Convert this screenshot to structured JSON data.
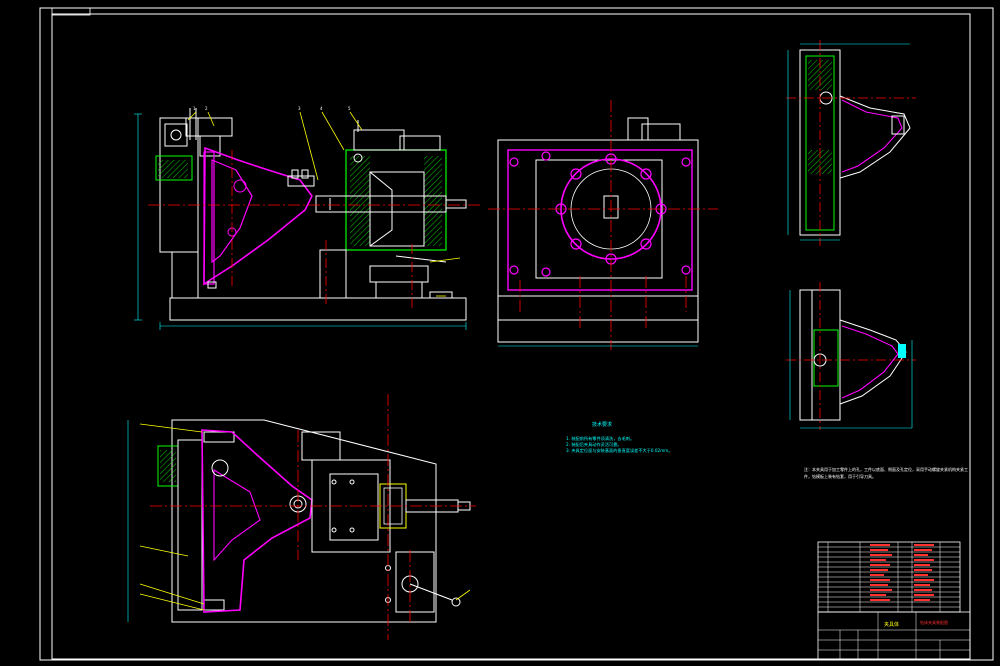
{
  "drawing": {
    "title_block": {
      "designation": "夹具体",
      "title": "钻床夹具装配图",
      "parts_table_rows": 14
    },
    "technical_requirements": {
      "heading": "技术要求",
      "items": [
        "1. 装配前所有零件须清洗，去毛刺。",
        "2. 装配后夹具动作灵活可靠。",
        "3. 夹具定位面与安装基面的垂直度误差不大于0.02mm。"
      ]
    },
    "side_notes": "注：本夹具用于加工零件上的孔，工件以底面、侧面及孔定位，采用手动螺旋夹紧机构夹紧工件，钻模板上装有钻套，用于引导刀具。"
  },
  "colors": {
    "background": "#000000",
    "outline": "#ffffff",
    "workpiece": "#ff00ff",
    "center_line": "#ff0000",
    "hatch": "#00ff00",
    "dimension": "#00ffff",
    "leader": "#ffff00"
  }
}
